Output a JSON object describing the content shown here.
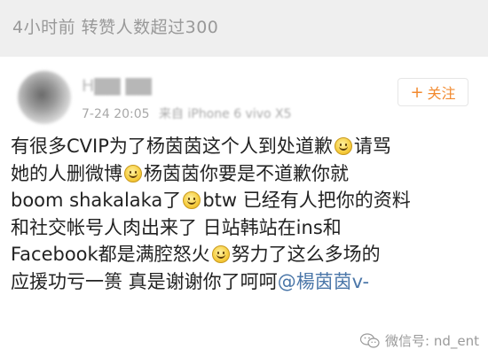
{
  "header": {
    "text": "4小时前 转赞人数超过300"
  },
  "post": {
    "username": "H▇▇ ▇▇",
    "time": "7-24 20:05",
    "source": "来自 iPhone 6 vivo X5",
    "follow_label": "关注",
    "lines": [
      {
        "t1": "有很多CVIP为了杨茵茵这个人到处道歉",
        "t2": "请骂"
      },
      {
        "t1": "她的人删微博",
        "t2": "杨茵茵你要是不道歉你就"
      },
      {
        "t1": "boom shakalaka了",
        "t2": "btw 已经有人把你的资料"
      },
      {
        "t1": "和社交帐号人肉出来了 日站韩站在ins和"
      },
      {
        "t1": "Facebook都是满腔怒火",
        "t2": "努力了这么多场的"
      },
      {
        "t1": "应援功亏一篑 真是谢谢你了呵呵",
        "mention": "@楊茵茵v-"
      }
    ]
  },
  "watermark": {
    "text": "微信号: nd_ent"
  },
  "icons": {
    "emoji": "smile-emoji",
    "follow": "plus-icon",
    "watermark": "wechat-icon"
  },
  "colors": {
    "follow_accent": "#f28a2f",
    "mention": "#4a76a8"
  }
}
